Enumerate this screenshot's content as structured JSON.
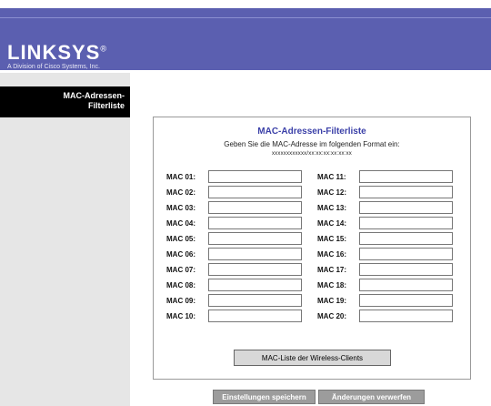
{
  "header": {
    "brand": "LINKSYS",
    "registered": "®",
    "tagline": "A Division of Cisco Systems, Inc."
  },
  "sidebar": {
    "active_item": "MAC-Adressen-\nFilterliste"
  },
  "panel": {
    "title": "MAC-Adressen-Filterliste",
    "instruction": "Geben Sie die MAC-Adresse im folgenden Format ein:",
    "format": "xxxxxxxxxxxx/xx:xx:xx:xx:xx:xx",
    "left_labels": [
      "MAC 01:",
      "MAC 02:",
      "MAC 03:",
      "MAC 04:",
      "MAC 05:",
      "MAC 06:",
      "MAC 07:",
      "MAC 08:",
      "MAC 09:",
      "MAC 10:"
    ],
    "right_labels": [
      "MAC 11:",
      "MAC 12:",
      "MAC 13:",
      "MAC 14:",
      "MAC 15:",
      "MAC 16:",
      "MAC 17:",
      "MAC 18:",
      "MAC 19:",
      "MAC 20:"
    ],
    "values": [
      "",
      "",
      "",
      "",
      "",
      "",
      "",
      "",
      "",
      "",
      "",
      "",
      "",
      "",
      "",
      "",
      "",
      "",
      "",
      ""
    ],
    "wireless_clients_button": "MAC-Liste der Wireless-Clients"
  },
  "footer": {
    "save_label": "Einstellungen speichern",
    "cancel_label": "Änderungen verwerfen"
  }
}
